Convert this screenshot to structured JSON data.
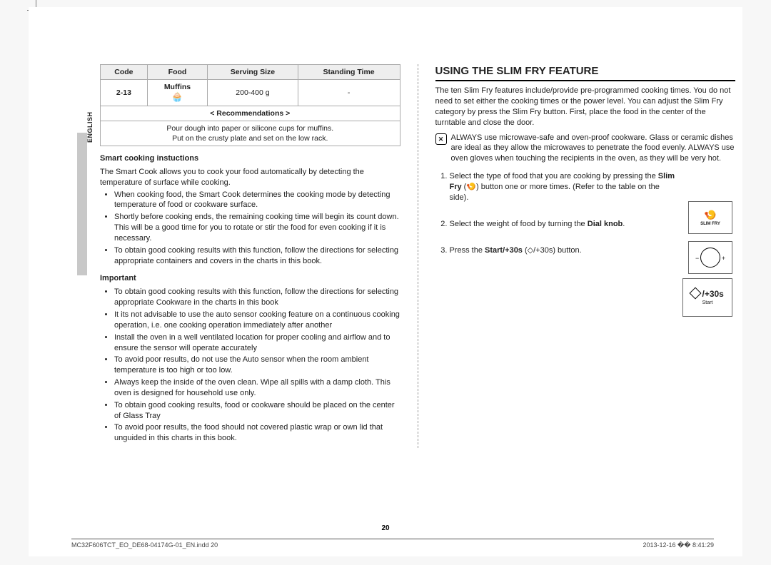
{
  "sidebar_label": "ENGLISH",
  "table": {
    "headers": {
      "code": "Code",
      "food": "Food",
      "size": "Serving Size",
      "time": "Standing Time"
    },
    "row": {
      "code": "2-13",
      "food": "Muffins",
      "size": "200-400 g",
      "time": "-"
    },
    "rec_header": "< Recommendations >",
    "rec_body": "Pour dough into paper or silicone cups for muffins.\nPut on the crusty plate and set on the low rack."
  },
  "left": {
    "h1": "Smart cooking instuctions",
    "p1": "The Smart Cook allows you to cook your food automatically by detecting the temperature of surface while cooking.",
    "b1": "When cooking food, the Smart Cook determines the cooking mode by detecting temperature of food or cookware surface.",
    "b2": "Shortly before cooking ends, the remaining cooking time will begin its count down. This will be a good time for you to rotate or stir the food for even cooking if it is necessary.",
    "b3": "To obtain good cooking results with this function, follow the directions for selecting appropriate containers and covers in the charts in this book.",
    "h2": "Important",
    "i1": "To obtain good cooking results with this function, follow the directions for selecting appropriate Cookware in the charts in this book",
    "i2": "It its not advisable to use the auto sensor cooking feature on a continuous cooking operation, i.e. one cooking operation immediately after another",
    "i3": "Install the oven in a well ventilated location for proper cooling and airflow and to ensure the sensor will operate accurately",
    "i4": "To avoid poor results, do not use the Auto sensor when the room ambient temperature is too high or too low.",
    "i5": "Always keep the inside of the oven clean. Wipe all spills with a damp cloth. This oven is designed for household use only.",
    "i6": "To obtain good cooking results, food or cookware should be placed on the center of Glass Tray",
    "i7": "To avoid poor results, the food should not covered plastic wrap or own lid that unguided in this charts in this book."
  },
  "right": {
    "title": "USING THE SLIM FRY FEATURE",
    "intro": "The ten Slim Fry features include/provide pre-programmed cooking times. You do not need to set either the cooking times or the power level. You can adjust the Slim Fry category by press the Slim Fry button. First, place the food in the center of the turntable and close the door.",
    "warn": "ALWAYS use microwave-safe and oven-proof cookware. Glass or ceramic dishes are ideal as they allow the microwaves to penetrate the food evenly. ALWAYS use oven gloves when touching the recipients in the oven, as they will be very hot.",
    "steps": {
      "s1a": "Select the type of food that you are cooking by pressing the ",
      "s1b": "Slim Fry",
      "s1c": " (🍤) button one or more times. (Refer to the table on the side).",
      "s2a": "Select the weight of food by turning the ",
      "s2b": "Dial knob",
      "s2c": ".",
      "s3a": "Press the ",
      "s3b": "Start/+30s",
      "s3c": " (◇/+30s) button."
    },
    "illus": {
      "slimfry": "SLIM FRY",
      "minus": "−",
      "plus": "+",
      "start_main": "+30s",
      "start_sub": "Start"
    }
  },
  "page_number": "20",
  "footer": {
    "left": "MC32F606TCT_EO_DE68-04174G-01_EN.indd   20",
    "right": "2013-12-16   �� 8:41:29"
  }
}
